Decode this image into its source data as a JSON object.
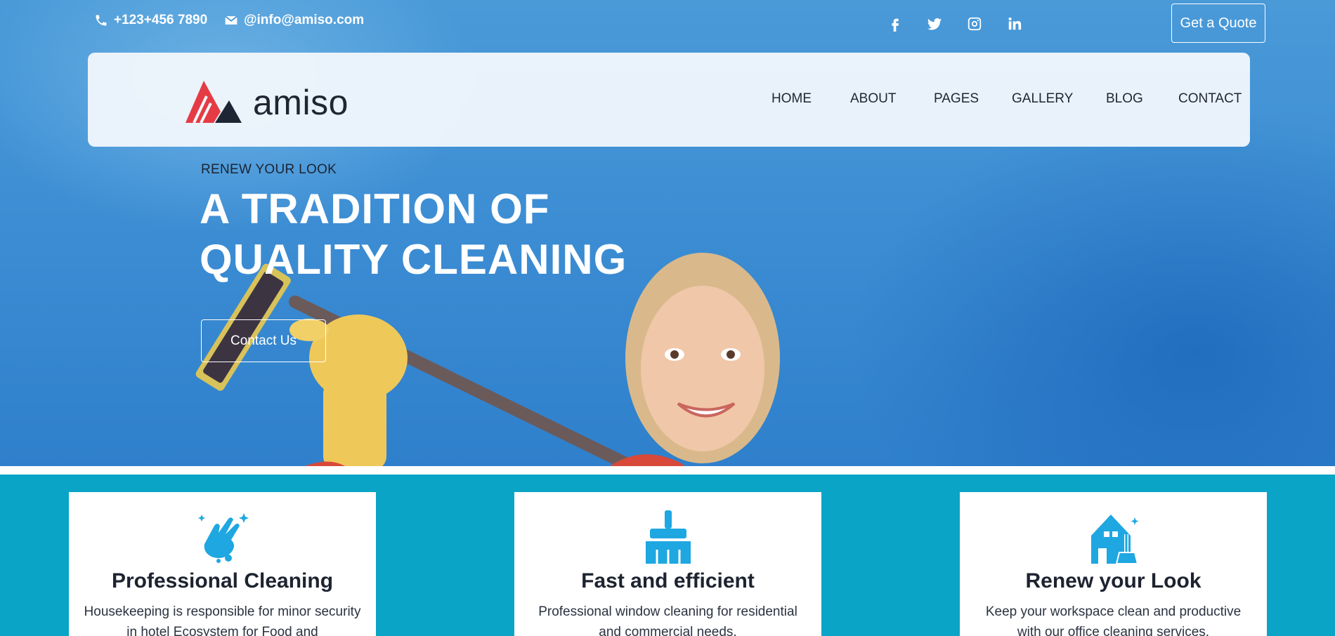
{
  "topbar": {
    "phone": "+123+456 7890",
    "email": "@info@amiso.com",
    "social": [
      "facebook-icon",
      "twitter-icon",
      "instagram-icon",
      "linkedin-icon"
    ],
    "quote_button": "Get a Quote"
  },
  "navbar": {
    "brand": "amiso",
    "items": [
      "HOME",
      "ABOUT",
      "PAGES",
      "GALLERY",
      "BLOG",
      "CONTACT"
    ]
  },
  "hero": {
    "eyebrow": "RENEW YOUR LOOK",
    "headline_line1": "A TRADITION OF",
    "headline_line2": "QUALITY CLEANING",
    "cta": "Contact Us"
  },
  "services": [
    {
      "icon": "hand-wash-icon",
      "title": "Professional Cleaning",
      "text": "Housekeeping is responsible for minor security in hotel Ecosystem for Food and"
    },
    {
      "icon": "brush-icon",
      "title": "Fast and efficient",
      "text": "Professional window cleaning for residential and commercial needs."
    },
    {
      "icon": "house-clean-icon",
      "title": "Renew your Look",
      "text": "Keep your workspace clean and productive with our office cleaning services."
    }
  ],
  "colors": {
    "hero_blue": "#3e8fd4",
    "services_teal": "#0aa5c6",
    "icon_blue": "#1ea7e1",
    "logo_red": "#e53b45"
  }
}
